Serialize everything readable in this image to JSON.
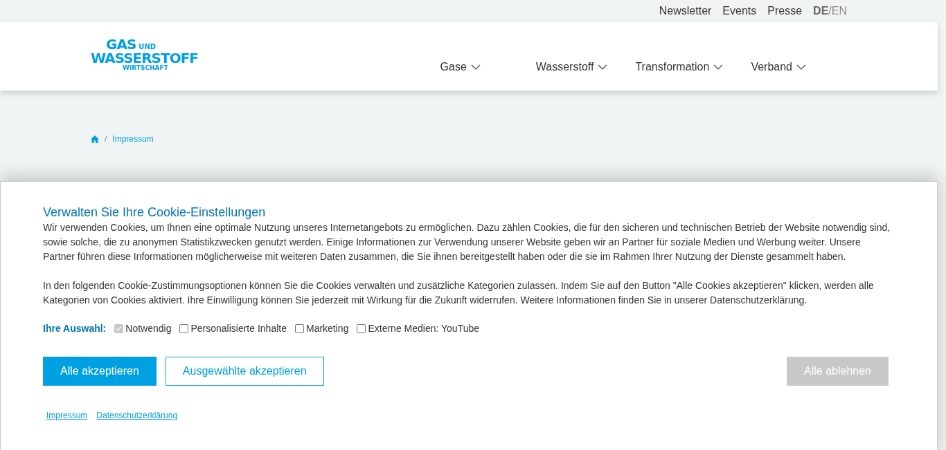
{
  "top_links": [
    "Newsletter",
    "Events",
    "Presse"
  ],
  "language_separator": "/",
  "languages": [
    {
      "label": "DE",
      "selected": true
    },
    {
      "label": "EN",
      "selected": false
    }
  ],
  "logo": {
    "line_1": "GAS",
    "line_1_small": "UND",
    "line_2": "WASSERSTOFF",
    "line_3": "WIRTSCHAFT"
  },
  "nav": [
    {
      "label": "Gase"
    },
    {
      "label": "Wasserstoff"
    },
    {
      "label": "Transformation"
    },
    {
      "label": "Verband"
    }
  ],
  "breadcrumb": {
    "separator": "/",
    "current": "Impressum"
  },
  "cookie_banner": {
    "title": "Verwalten Sie Ihre Cookie-Einstellungen",
    "paragraphs": [
      "Wir verwenden Cookies, um Ihnen eine optimale Nutzung unseres Internetangebots zu ermöglichen. Dazu zählen Cookies, die für den sicheren und technischen Betrieb der Website notwendig sind, sowie solche, die zu anonymen Statistikzwecken genutzt werden. Einige Informationen zur Verwendung unserer Website geben wir an Partner für soziale Medien und Werbung weiter. Unsere Partner führen diese Informationen möglicherweise mit weiteren Daten zusammen, die Sie ihnen bereitgestellt haben oder die sie im Rahmen Ihrer Nutzung der Dienste gesammelt haben.",
      "In den folgenden Cookie-Zustimmungsoptionen können Sie die Cookies verwalten und zusätzliche Kategorien zulassen. Indem Sie auf den Button \"Alle Cookies akzeptieren\" klicken, werden alle Kategorien von Cookies aktiviert. Ihre Einwilligung können Sie jederzeit mit Wirkung für die Zukunft widerrufen. Weitere Informationen finden Sie in unserer Datenschutzerklärung."
    ],
    "choice_label": "Ihre Auswahl:",
    "options": [
      {
        "label": "Notwendig",
        "checked": true,
        "disabled": true
      },
      {
        "label": "Personalisierte Inhalte",
        "checked": false,
        "disabled": false
      },
      {
        "label": "Marketing",
        "checked": false,
        "disabled": false
      },
      {
        "label": "Externe Medien: YouTube",
        "checked": false,
        "disabled": false
      }
    ],
    "buttons": [
      {
        "label": "Alle akzeptieren",
        "kind": "primary"
      },
      {
        "label": "Ausgewählte akzeptieren",
        "kind": "outline"
      },
      {
        "label": "Alle ablehnen",
        "kind": "muted"
      }
    ],
    "footer_links": [
      "Impressum",
      "Datenschutzerklärung"
    ]
  }
}
